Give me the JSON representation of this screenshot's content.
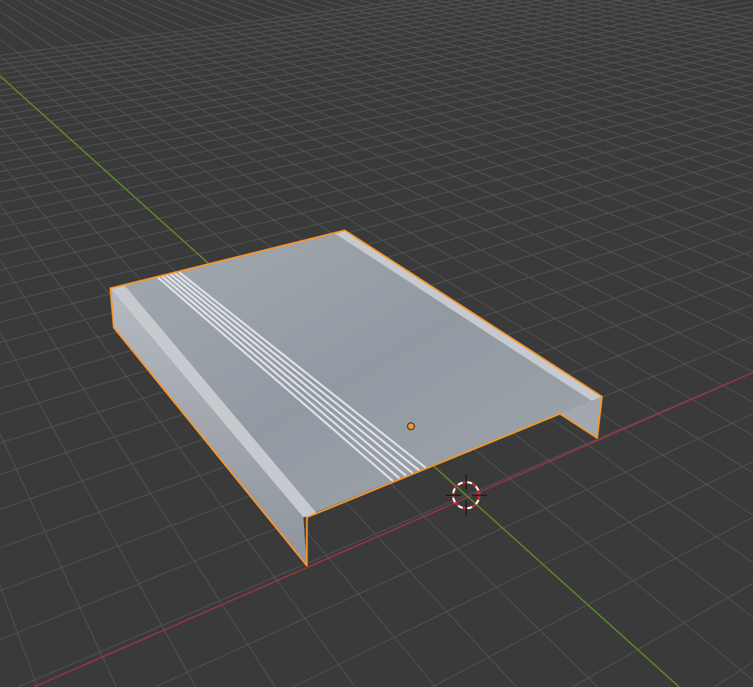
{
  "viewport": {
    "background": "#3a3a3a",
    "grid_color": "#525252",
    "x_axis_color": "#9a3444",
    "y_axis_color": "#5f8a22",
    "selection_color": "#f5962a"
  },
  "object": {
    "name_visible": false,
    "surface_color": "#9aa0a8",
    "curb_color": "#c4c8cd",
    "stripe_color": "#dfe2e6",
    "stripe_count": 6
  }
}
